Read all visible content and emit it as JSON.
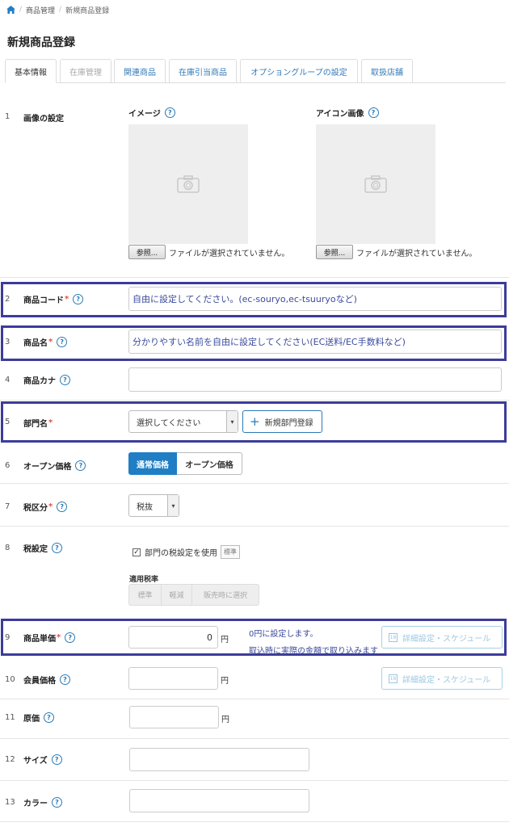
{
  "breadcrumb": {
    "items": [
      "商品管理",
      "新規商品登録"
    ]
  },
  "page": {
    "title": "新規商品登録"
  },
  "tabs": [
    {
      "label": "基本情報",
      "state": "active"
    },
    {
      "label": "在庫管理",
      "state": "disabled"
    },
    {
      "label": "関連商品",
      "state": "normal"
    },
    {
      "label": "在庫引当商品",
      "state": "normal"
    },
    {
      "label": "オプショングループの設定",
      "state": "normal"
    },
    {
      "label": "取扱店舗",
      "state": "normal"
    }
  ],
  "rows": {
    "image": {
      "num": "1",
      "label": "画像の設定"
    },
    "code": {
      "num": "2",
      "label": "商品コード",
      "required": "*"
    },
    "name": {
      "num": "3",
      "label": "商品名",
      "required": "*"
    },
    "kana": {
      "num": "4",
      "label": "商品カナ"
    },
    "dept": {
      "num": "5",
      "label": "部門名",
      "required": "*"
    },
    "open": {
      "num": "6",
      "label": "オープン価格"
    },
    "taxclass": {
      "num": "7",
      "label": "税区分",
      "required": "*"
    },
    "taxsetting": {
      "num": "8",
      "label": "税設定"
    },
    "unitprice": {
      "num": "9",
      "label": "商品単価",
      "required": "*"
    },
    "memberprice": {
      "num": "10",
      "label": "会員価格"
    },
    "cost": {
      "num": "11",
      "label": "原価"
    },
    "size": {
      "num": "12",
      "label": "サイズ"
    },
    "color": {
      "num": "13",
      "label": "カラー"
    }
  },
  "images": {
    "image_title": "イメージ",
    "icon_title": "アイコン画像",
    "browse_label": "参照...",
    "no_file": "ファイルが選択されていません。"
  },
  "fields": {
    "code_hint": "自由に設定してください。(ec-souryo,ec-tsuuryoなど)",
    "name_hint": "分かりやすい名前を自由に設定してください(EC送料/EC手数料など)",
    "dept_select": "選択してください",
    "dept_new_button": "新規部門登録",
    "open_normal": "通常価格",
    "open_open": "オープン価格",
    "taxclass_value": "税抜",
    "tax_use_dept": "部門の税設定を使用",
    "tax_std_tag": "標準",
    "applied_rate_label": "適用税率",
    "rate_options": [
      "標準",
      "軽減",
      "販売時に選択"
    ],
    "unitprice_value": "0",
    "yen": "円",
    "note_line1": "0円に設定します。",
    "note_line2": "取込時に実際の金額で取り込みます",
    "detail_button": "詳細設定・スケジュール",
    "help_glyph": "?",
    "required_mark": "*"
  },
  "colors": {
    "accent": "#1f7ec4",
    "highlight_border": "#3c3c9b",
    "hint_text": "#3b4a9c"
  }
}
